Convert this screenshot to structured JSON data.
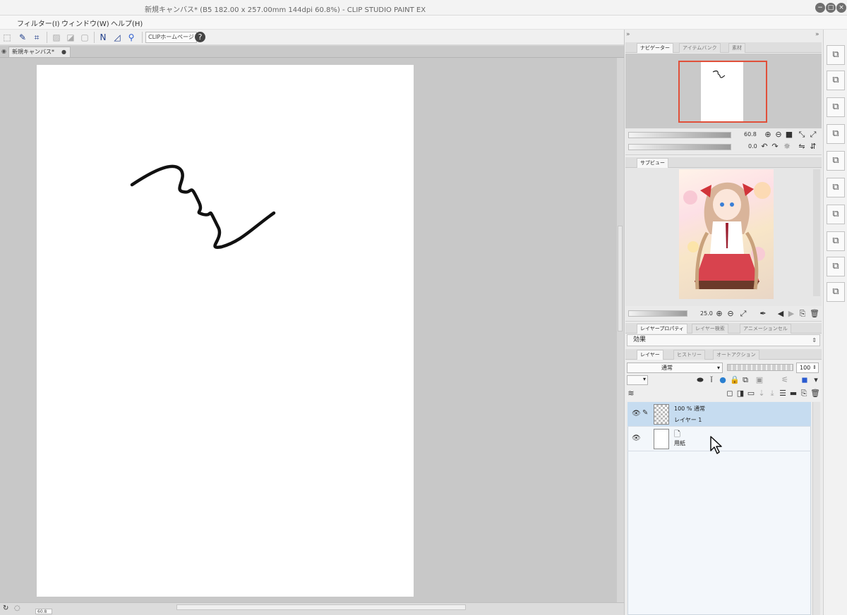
{
  "window": {
    "title": "新規キャンバス* (B5 182.00 x 257.00mm 144dpi 60.8%) - CLIP STUDIO PAINT EX",
    "min_glyph": "−",
    "max_glyph": "□",
    "close_glyph": "×"
  },
  "menu": {
    "items": [
      "フィルター(I)",
      "ウィンドウ(W)",
      "ヘルプ(H)"
    ]
  },
  "toolbar": {
    "home_button_label": "CLIPホームページ",
    "help_glyph": "?"
  },
  "canvas": {
    "tab_label": "新規キャンバス*",
    "zoom_readout": "60.8"
  },
  "navigator": {
    "tabs": [
      "ナビゲーター",
      "アイテムバンク",
      "素材"
    ],
    "zoom_value": "60.8",
    "rotate_value": "0.0"
  },
  "subview": {
    "tab_label": "サブビュー",
    "zoom_value": "25.0"
  },
  "layer_property": {
    "tabs": [
      "レイヤープロパティ",
      "レイヤー検索",
      "アニメーションセル"
    ],
    "effect_label": "効果"
  },
  "layer_panel": {
    "tabs": [
      "レイヤー",
      "ヒストリー",
      "オートアクション"
    ],
    "blend_mode": "通常",
    "opacity": "100",
    "layers": [
      {
        "opacity_mode": "100 % 通常",
        "name": "レイヤー 1",
        "selected": true
      },
      {
        "opacity_mode": "",
        "name": "用紙",
        "selected": false
      }
    ]
  },
  "colors": {
    "selected_layer": "#c6dcf0",
    "navigator_frame": "#e0503a"
  }
}
